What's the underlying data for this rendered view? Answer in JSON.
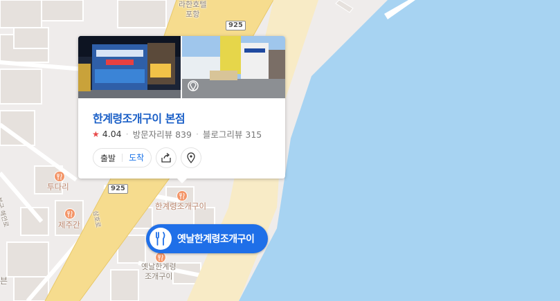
{
  "map": {
    "colors": {
      "sea": "#a7d3f2",
      "land": "#efeceb",
      "beach": "#f8ebc6",
      "road_major": "#f6dc8e",
      "block": "#e7e2de",
      "road_minor": "#ffffff"
    },
    "labels": {
      "hotel_line1": "라한호텔",
      "hotel_line2": "포항",
      "road_925_top": "925",
      "road_925_bottom": "925",
      "tudari": "투다리",
      "jejugan": "제주간",
      "hangyeryeong_poi": "한계령조개구이",
      "old_hangyeryeong_line1": "옛날한계령",
      "old_hangyeryeong_line2": "조개구이",
      "road_vertical": "삼호로",
      "left_edge_text": "븐",
      "left_street_text": "북구 해안로"
    }
  },
  "card": {
    "title": "한계령조개구이 본점",
    "rating": "4.04",
    "visitor_reviews": "방문자리뷰 839",
    "blog_reviews": "블로그리뷰 315",
    "depart_label": "출발",
    "arrive_label": "도착",
    "share_icon": "share-icon",
    "location_icon": "location-pin-icon"
  },
  "marker": {
    "label": "옛날한계령조개구이",
    "icon": "restaurant-icon"
  }
}
